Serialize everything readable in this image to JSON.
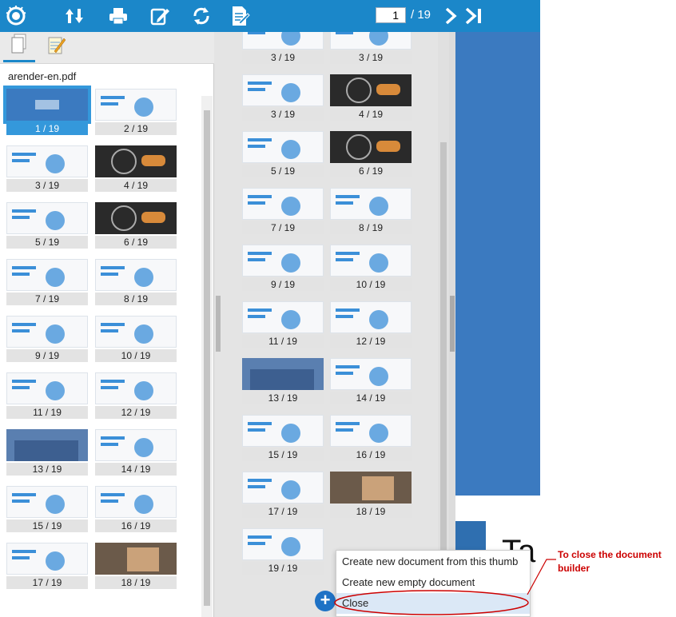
{
  "toolbar": {
    "current_page": "1",
    "page_total": "/ 19",
    "icons": [
      "app-logo-icon",
      "sort-icon",
      "print-icon",
      "annotate-icon",
      "rotate-icon",
      "document-builder-icon",
      "next-page-icon",
      "last-page-icon"
    ]
  },
  "left_panel": {
    "document_name": "arender-en.pdf",
    "thumbs": [
      "1 / 19",
      "2 / 19",
      "3 / 19",
      "4 / 19",
      "5 / 19",
      "6 / 19",
      "7 / 19",
      "8 / 19",
      "9 / 19",
      "10 / 19",
      "11 / 19",
      "12 / 19",
      "13 / 19",
      "14 / 19",
      "15 / 19",
      "16 / 19",
      "17 / 19",
      "18 / 19"
    ]
  },
  "builder": {
    "thumbs": [
      "3 / 19",
      "3 / 19",
      "3 / 19",
      "4 / 19",
      "5 / 19",
      "6 / 19",
      "7 / 19",
      "8 / 19",
      "9 / 19",
      "10 / 19",
      "11 / 19",
      "12 / 19",
      "13 / 19",
      "14 / 19",
      "15 / 19",
      "16 / 19",
      "17 / 19",
      "18 / 19",
      "19 / 19"
    ]
  },
  "menu": {
    "items": [
      "Create new document from this thumb",
      "Create new empty document",
      "Close"
    ]
  },
  "viewer": {
    "text": "Ta"
  },
  "annotation": {
    "text": "To close the document builder",
    "color": "#cc0000"
  },
  "colors": {
    "accent": "#1b87c9",
    "selected": "#3498db"
  }
}
